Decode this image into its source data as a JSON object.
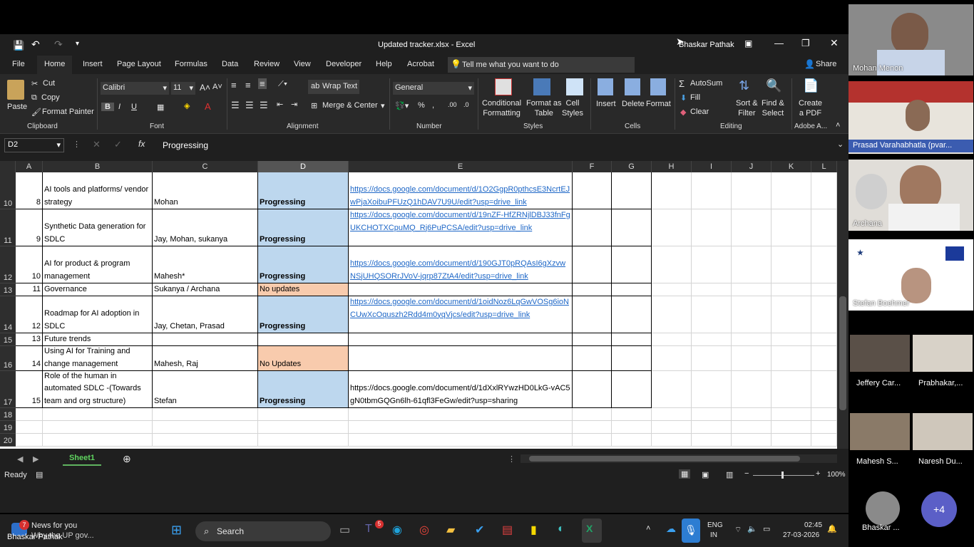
{
  "window": {
    "title": "Updated tracker.xlsx  -  Excel",
    "user": "Bhaskar Pathak"
  },
  "menu": [
    "File",
    "Home",
    "Insert",
    "Page Layout",
    "Formulas",
    "Data",
    "Review",
    "View",
    "Developer",
    "Help",
    "Acrobat"
  ],
  "tell_me": "Tell me what you want to do",
  "share": "Share",
  "ribbon": {
    "clipboard": {
      "paste": "Paste",
      "cut": "Cut",
      "copy": "Copy",
      "format_painter": "Format Painter",
      "group": "Clipboard"
    },
    "font": {
      "name": "Calibri",
      "size": "11",
      "group": "Font"
    },
    "alignment": {
      "wrap": "Wrap Text",
      "merge": "Merge & Center",
      "group": "Alignment"
    },
    "number": {
      "format": "General",
      "group": "Number"
    },
    "styles": {
      "cond": "Conditional\nFormatting",
      "format_table": "Format as\nTable",
      "cell_styles": "Cell\nStyles",
      "group": "Styles"
    },
    "cells": {
      "insert": "Insert",
      "delete": "Delete",
      "format": "Format",
      "group": "Cells"
    },
    "editing": {
      "autosum": "AutoSum",
      "fill": "Fill",
      "clear": "Clear",
      "sort": "Sort &\nFilter",
      "find": "Find &\nSelect",
      "group": "Editing"
    },
    "adobe": {
      "create": "Create\na PDF",
      "group": "Adobe A..."
    }
  },
  "formula_bar": {
    "name_box": "D2",
    "content": "Progressing"
  },
  "columns": [
    "A",
    "B",
    "C",
    "D",
    "E",
    "F",
    "G",
    "H",
    "I",
    "J",
    "K",
    "L"
  ],
  "rows": [
    {
      "n": "10",
      "a": "8",
      "b": "AI tools and platforms/ vendor strategy",
      "c": "Mohan",
      "d": "Progressing",
      "e": "https://docs.google.com/document/d/1O2GgpR0pthcsE3NcrtEJwPjaXoibuPFUzQ1hDAV7U9U/edit?usp=drive_link"
    },
    {
      "n": "11",
      "a": "9",
      "b": "Synthetic Data generation for SDLC",
      "c": "Jay, Mohan, sukanya",
      "d": "Progressing",
      "e": "https://docs.google.com/document/d/19nZF-HfZRNjlDBJ33fnFgUKCHOTXCpuMQ_Rj6PuPCSA/edit?usp=drive_link"
    },
    {
      "n": "12",
      "a": "10",
      "b": "AI for product & program management",
      "c": "Mahesh*",
      "d": "Progressing",
      "e": "https://docs.google.com/document/d/190GJT0pRQAsI6gXzvwNSjUHQSORrJVoV-jqrp87ZtA4/edit?usp=drive_link"
    },
    {
      "n": "13",
      "a": "11",
      "b": "Governance",
      "c": "Sukanya / Archana",
      "d": "No updates",
      "e": ""
    },
    {
      "n": "14",
      "a": "12",
      "b": "Roadmap for AI adoption in SDLC",
      "c": "Jay, Chetan, Prasad",
      "d": "Progressing",
      "e": "https://docs.google.com/document/d/1oidNoz6LqGwVOSg6ioNCUwXcOquszh2Rdd4m0yqVjcs/edit?usp=drive_link"
    },
    {
      "n": "15",
      "a": "13",
      "b": "Future trends",
      "c": "",
      "d": "",
      "e": ""
    },
    {
      "n": "16",
      "a": "14",
      "b": "Using AI for Training and change management",
      "c": "Mahesh, Raj",
      "d": "No Updates",
      "e": ""
    },
    {
      "n": "17",
      "a": "15",
      "b": "Role of the human in automated SDLC -(Towards team and org structure)",
      "c": "Stefan",
      "d": "Progressing",
      "e": "https://docs.google.com/document/d/1dXxlRYwzHD0LkG-vAC5gN0tbmGQGn6lh-61qfl3FeGw/edit?usp=sharing"
    },
    {
      "n": "18"
    },
    {
      "n": "19"
    },
    {
      "n": "20"
    }
  ],
  "sheet": {
    "tab": "Sheet1"
  },
  "status": {
    "ready": "Ready",
    "zoom": "100%"
  },
  "taskbar": {
    "news_title": "News for you",
    "news_sub": "Why the UP gov...",
    "news_badge": "7",
    "search": "Search",
    "teams_badge": "5",
    "lang1": "ENG",
    "lang2": "IN",
    "time": "02:45",
    "date": "27-03-2026"
  },
  "participants": [
    {
      "name": "Mohan Menon"
    },
    {
      "name": "Prasad Varahabhatla (pvar..."
    },
    {
      "name": "Archana"
    },
    {
      "name": "Stefan Boehmer"
    }
  ],
  "small_participants": [
    "Jeffery Car...",
    "Prabhakar,...",
    "Mahesh S...",
    "Naresh Du..."
  ],
  "self": {
    "name": "Bhaskar ...",
    "more": "+4"
  },
  "bottom_name": "Bhaskar Pathak"
}
